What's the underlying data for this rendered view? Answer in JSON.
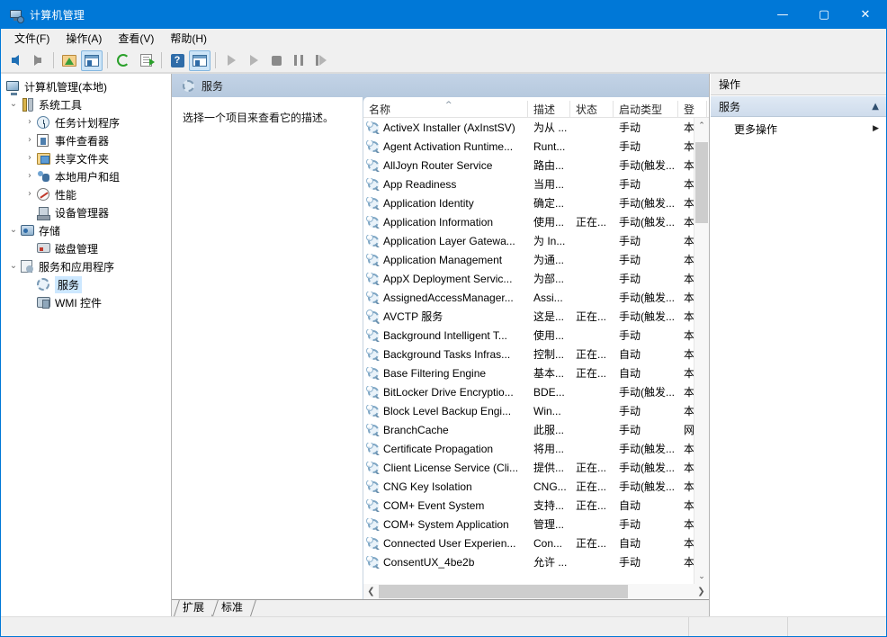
{
  "window": {
    "title": "计算机管理",
    "app_icon": "computer-management-icon",
    "minimize": "—",
    "maximize": "▢",
    "close": "✕"
  },
  "menu": [
    {
      "label": "文件(F)",
      "name": "menu-file"
    },
    {
      "label": "操作(A)",
      "name": "menu-action"
    },
    {
      "label": "查看(V)",
      "name": "menu-view"
    },
    {
      "label": "帮助(H)",
      "name": "menu-help"
    }
  ],
  "toolbar": [
    {
      "name": "back-button",
      "icon": "arrow-left-icon"
    },
    {
      "name": "forward-button",
      "icon": "arrow-right-icon"
    },
    {
      "name": "up-folder-button",
      "icon": "folder-up-icon"
    },
    {
      "name": "show-hide-tree-button",
      "icon": "console-tree-icon"
    },
    {
      "name": "refresh-button",
      "icon": "refresh-icon"
    },
    {
      "name": "export-list-button",
      "icon": "export-icon"
    },
    {
      "name": "help-button",
      "icon": "help-icon"
    },
    {
      "name": "properties-button",
      "icon": "properties-icon"
    },
    {
      "name": "start-service-button",
      "icon": "play-icon"
    },
    {
      "name": "resume-service-button",
      "icon": "play-outline-icon"
    },
    {
      "name": "stop-service-button",
      "icon": "stop-icon"
    },
    {
      "name": "pause-service-button",
      "icon": "pause-icon"
    },
    {
      "name": "restart-service-button",
      "icon": "restart-icon"
    }
  ],
  "tree": {
    "root": {
      "label": "计算机管理(本地)",
      "icon": "computer-icon"
    },
    "items": [
      {
        "label": "系统工具",
        "icon": "system-tools-icon",
        "chevron": "⌄",
        "depth": 1,
        "selected": false
      },
      {
        "label": "任务计划程序",
        "icon": "task-scheduler-icon",
        "chevron": "›",
        "depth": 2,
        "selected": false
      },
      {
        "label": "事件查看器",
        "icon": "event-viewer-icon",
        "chevron": "›",
        "depth": 2,
        "selected": false
      },
      {
        "label": "共享文件夹",
        "icon": "shared-folders-icon",
        "chevron": "›",
        "depth": 2,
        "selected": false
      },
      {
        "label": "本地用户和组",
        "icon": "local-users-groups-icon",
        "chevron": "›",
        "depth": 2,
        "selected": false
      },
      {
        "label": "性能",
        "icon": "performance-icon",
        "chevron": "›",
        "depth": 2,
        "selected": false
      },
      {
        "label": "设备管理器",
        "icon": "device-manager-icon",
        "chevron": "",
        "depth": 2,
        "selected": false
      },
      {
        "label": "存储",
        "icon": "storage-icon",
        "chevron": "⌄",
        "depth": 1,
        "selected": false
      },
      {
        "label": "磁盘管理",
        "icon": "disk-management-icon",
        "chevron": "",
        "depth": 2,
        "selected": false
      },
      {
        "label": "服务和应用程序",
        "icon": "services-applications-icon",
        "chevron": "⌄",
        "depth": 1,
        "selected": false
      },
      {
        "label": "服务",
        "icon": "services-icon",
        "chevron": "",
        "depth": 2,
        "selected": true
      },
      {
        "label": "WMI 控件",
        "icon": "wmi-control-icon",
        "chevron": "",
        "depth": 2,
        "selected": false
      }
    ]
  },
  "main": {
    "header_title": "服务",
    "header_icon": "services-gear-icon",
    "description": "选择一个项目来查看它的描述。",
    "columns": [
      {
        "label": "名称",
        "sort": "^"
      },
      {
        "label": "描述",
        "sort": ""
      },
      {
        "label": "状态",
        "sort": ""
      },
      {
        "label": "启动类型",
        "sort": ""
      },
      {
        "label": "登",
        "sort": ""
      }
    ],
    "rows": [
      {
        "name": "ActiveX Installer (AxInstSV)",
        "desc": "为从 ...",
        "status": "",
        "startup": "手动",
        "logon": "本"
      },
      {
        "name": "Agent Activation Runtime...",
        "desc": "Runt...",
        "status": "",
        "startup": "手动",
        "logon": "本"
      },
      {
        "name": "AllJoyn Router Service",
        "desc": "路由...",
        "status": "",
        "startup": "手动(触发...",
        "logon": "本"
      },
      {
        "name": "App Readiness",
        "desc": "当用...",
        "status": "",
        "startup": "手动",
        "logon": "本"
      },
      {
        "name": "Application Identity",
        "desc": "确定...",
        "status": "",
        "startup": "手动(触发...",
        "logon": "本"
      },
      {
        "name": "Application Information",
        "desc": "使用...",
        "status": "正在...",
        "startup": "手动(触发...",
        "logon": "本"
      },
      {
        "name": "Application Layer Gatewa...",
        "desc": "为 In...",
        "status": "",
        "startup": "手动",
        "logon": "本"
      },
      {
        "name": "Application Management",
        "desc": "为通...",
        "status": "",
        "startup": "手动",
        "logon": "本"
      },
      {
        "name": "AppX Deployment Servic...",
        "desc": "为部...",
        "status": "",
        "startup": "手动",
        "logon": "本"
      },
      {
        "name": "AssignedAccessManager...",
        "desc": "Assi...",
        "status": "",
        "startup": "手动(触发...",
        "logon": "本"
      },
      {
        "name": "AVCTP 服务",
        "desc": "这是...",
        "status": "正在...",
        "startup": "手动(触发...",
        "logon": "本"
      },
      {
        "name": "Background Intelligent T...",
        "desc": "使用...",
        "status": "",
        "startup": "手动",
        "logon": "本"
      },
      {
        "name": "Background Tasks Infras...",
        "desc": "控制...",
        "status": "正在...",
        "startup": "自动",
        "logon": "本"
      },
      {
        "name": "Base Filtering Engine",
        "desc": "基本...",
        "status": "正在...",
        "startup": "自动",
        "logon": "本"
      },
      {
        "name": "BitLocker Drive Encryptio...",
        "desc": "BDE...",
        "status": "",
        "startup": "手动(触发...",
        "logon": "本"
      },
      {
        "name": "Block Level Backup Engi...",
        "desc": "Win...",
        "status": "",
        "startup": "手动",
        "logon": "本"
      },
      {
        "name": "BranchCache",
        "desc": "此服...",
        "status": "",
        "startup": "手动",
        "logon": "网"
      },
      {
        "name": "Certificate Propagation",
        "desc": "将用...",
        "status": "",
        "startup": "手动(触发...",
        "logon": "本"
      },
      {
        "name": "Client License Service (Cli...",
        "desc": "提供...",
        "status": "正在...",
        "startup": "手动(触发...",
        "logon": "本"
      },
      {
        "name": "CNG Key Isolation",
        "desc": "CNG...",
        "status": "正在...",
        "startup": "手动(触发...",
        "logon": "本"
      },
      {
        "name": "COM+ Event System",
        "desc": "支持...",
        "status": "正在...",
        "startup": "自动",
        "logon": "本"
      },
      {
        "name": "COM+ System Application",
        "desc": "管理...",
        "status": "",
        "startup": "手动",
        "logon": "本"
      },
      {
        "name": "Connected User Experien...",
        "desc": "Con...",
        "status": "正在...",
        "startup": "自动",
        "logon": "本"
      },
      {
        "name": "ConsentUX_4be2b",
        "desc": "允许 ...",
        "status": "",
        "startup": "手动",
        "logon": "本"
      }
    ],
    "tabs": [
      {
        "label": "扩展",
        "active": false
      },
      {
        "label": "标准",
        "active": true
      }
    ],
    "scroll": {
      "up_arrow": "⌃",
      "down_arrow": "⌄",
      "left_arrow": "❮",
      "right_arrow": "❯"
    }
  },
  "actions": {
    "title": "操作",
    "section": "服务",
    "collapse_glyph": "▲",
    "items": [
      {
        "label": "更多操作",
        "submenu_glyph": "▶"
      }
    ]
  },
  "colors": {
    "titlebar": "#0078d7",
    "selection": "#cde8ff",
    "pane_header": "#b6c9de",
    "action_section": "#dfe9f4"
  }
}
